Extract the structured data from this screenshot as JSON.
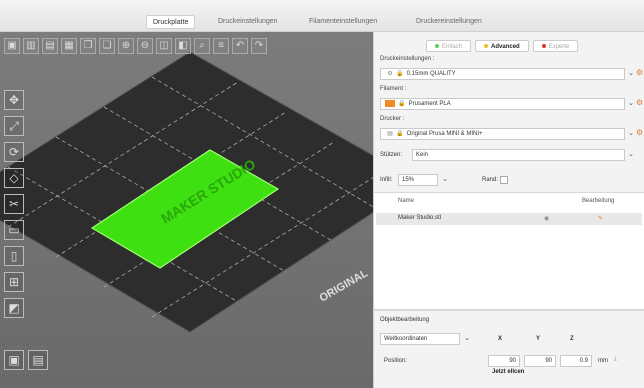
{
  "tabs": [
    {
      "label": "Druckplatte"
    },
    {
      "label": "Druckeinstellungen"
    },
    {
      "label": "Filamenteinstellungen"
    },
    {
      "label": "Druckereinstellungen"
    }
  ],
  "modes": {
    "simple": "Einfach",
    "advanced": "Advanced",
    "expert": "Experte"
  },
  "print_settings": {
    "label": "Druckeinstellungen :",
    "value": "0.15mm QUALITY"
  },
  "filament": {
    "label": "Filament :",
    "value": "Prusament PLA"
  },
  "printer": {
    "label": "Drucker :",
    "value": "Original Prusa MINI & MINI+"
  },
  "support": {
    "label": "Stützen:",
    "value": "Kein"
  },
  "infill": {
    "label": "Infill:",
    "value": "15%"
  },
  "brim": {
    "label": "Rand:"
  },
  "objects": {
    "col_name": "Name",
    "col_edit": "Bearbeitung",
    "rows": [
      {
        "name": "Maker Studio.stl"
      }
    ]
  },
  "object_edit": {
    "title": "Objektbearbeitung",
    "coords": "Weltkoordinaten",
    "x": "X",
    "y": "Y",
    "z": "Z",
    "position_label": "Position:",
    "pos_x": "90",
    "pos_y": "90",
    "pos_z": "0.9",
    "unit": "mm",
    "apply": "Jetzt ellcen"
  },
  "bed": {
    "brand_text": "ORIGINAL",
    "model_text": "MAKER STUDIO"
  },
  "colors": {
    "accent": "#ef8a25",
    "model": "#3ee011",
    "bed": "#2f2f2f"
  }
}
